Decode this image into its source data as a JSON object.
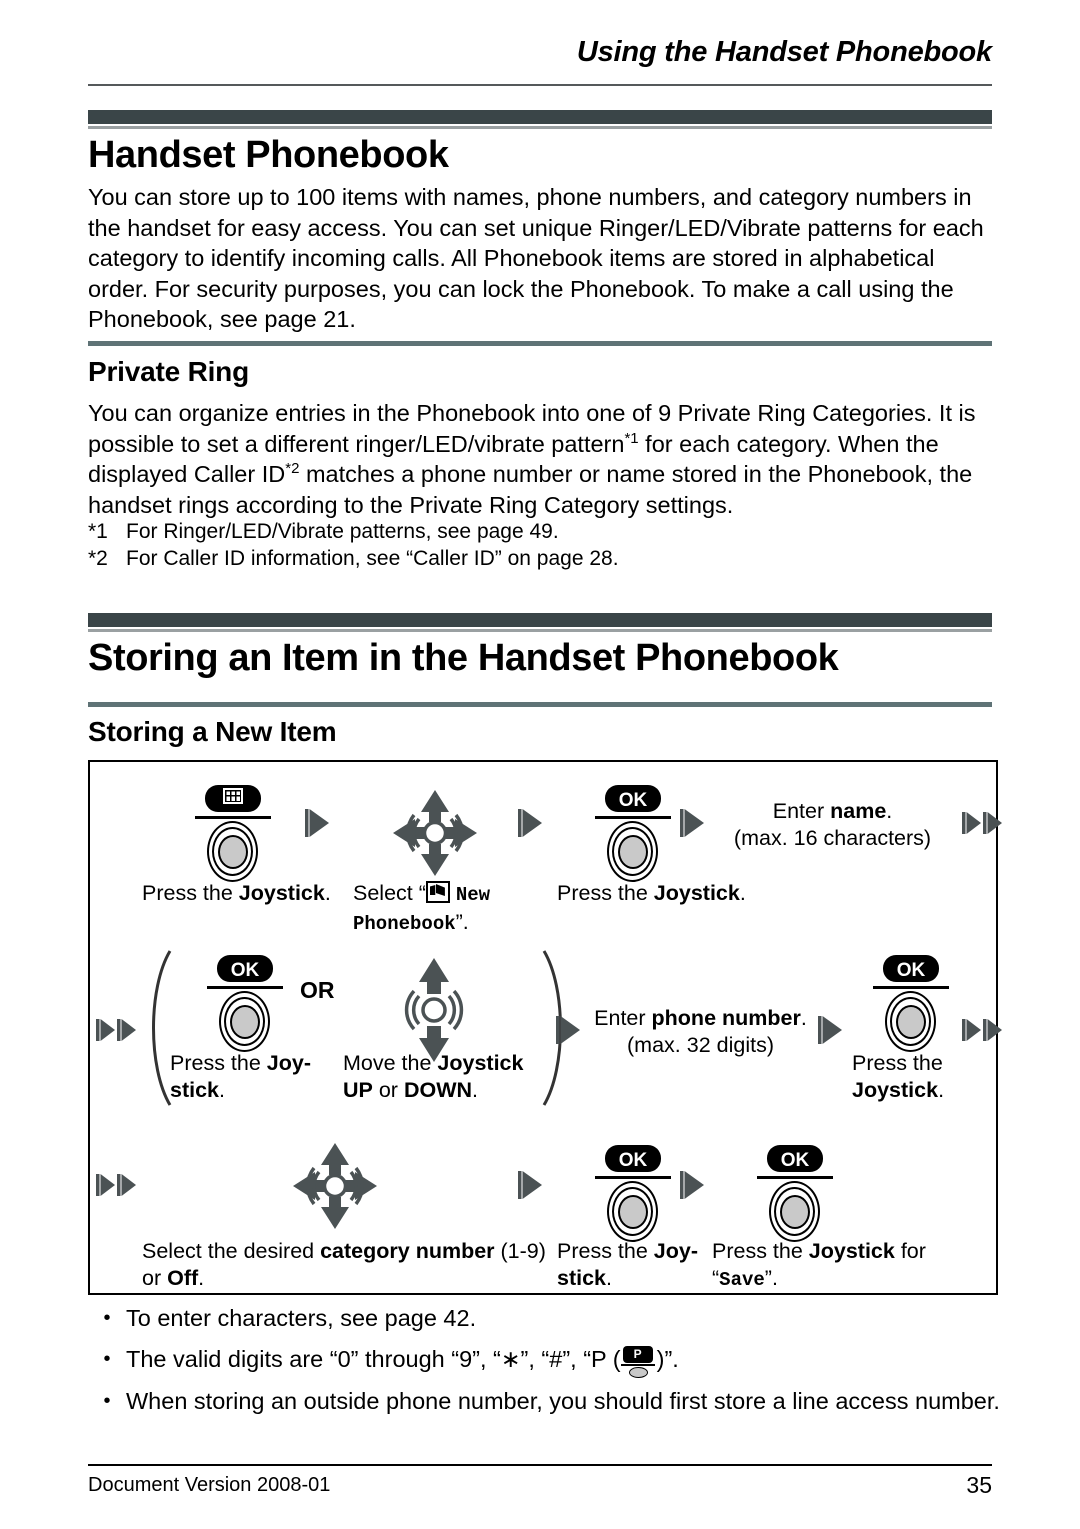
{
  "running_head": "Using the Handset Phonebook",
  "sections": {
    "handset_phonebook": {
      "title": "Handset Phonebook",
      "intro": "You can store up to 100 items with names, phone numbers, and category numbers in the handset for easy access. You can set unique Ringer/LED/Vibrate patterns for each category to identify incoming calls. All Phonebook items are stored in alphabetical order. For security purposes, you can lock the Phonebook. To make a call using the Phonebook, see page 21."
    },
    "private_ring": {
      "title": "Private Ring",
      "para_1": "You can organize entries in the Phonebook into one of 9 Private Ring Categories. It is possible to set a different ringer/LED/vibrate pattern",
      "sup_1": "*1",
      "para_2": " for each category. When the displayed Caller ID",
      "sup_2": "*2",
      "para_3": " matches a phone number or name stored in the Phonebook, the handset rings according to the Private Ring Category settings.",
      "footnotes": [
        {
          "marker": "*1",
          "text": "For Ringer/LED/Vibrate patterns, see page 49."
        },
        {
          "marker": "*2",
          "text": "For Caller ID information, see “Caller ID” on page 28."
        }
      ]
    },
    "storing_item": {
      "title": "Storing an Item in the Handset Phonebook",
      "subtitle": "Storing a New Item"
    }
  },
  "procedure": {
    "row1": {
      "step1": {
        "key_icon": "menu-key-icon",
        "caption_pre": "Press the ",
        "caption_bold": "Joystick",
        "caption_post": "."
      },
      "step2": {
        "nav_icon": "joystick-4way-icon",
        "caption_pre": "Select “",
        "caption_icon": "phonebook-glyph-icon",
        "caption_mono": "New Phonebook",
        "caption_post": "”."
      },
      "step3": {
        "key_icon": "ok-key-icon",
        "key_label": "OK",
        "caption_pre": "Press the ",
        "caption_bold": "Joystick",
        "caption_post": "."
      },
      "step4": {
        "line1_pre": "Enter ",
        "line1_bold": "name",
        "line1_post": ".",
        "line2": "(max. 16 characters)"
      }
    },
    "row2": {
      "step1": {
        "key_icon": "ok-key-icon",
        "key_label": "OK",
        "caption_pre": "Press the ",
        "caption_bold": "Joy-",
        "caption_bold2": "stick",
        "caption_post": "."
      },
      "or_label": "OR",
      "step2": {
        "nav_icon": "joystick-updown-icon",
        "caption_pre": "Move the ",
        "caption_bold": "Joystick",
        "caption_bold2": "UP",
        "caption_mid": " or ",
        "caption_bold3": "DOWN",
        "caption_post": "."
      },
      "step3": {
        "line1_pre": "Enter ",
        "line1_bold": "phone number",
        "line1_post": ".",
        "line2": "(max. 32 digits)"
      },
      "step4": {
        "key_icon": "ok-key-icon",
        "key_label": "OK",
        "caption_pre": "Press the",
        "caption_bold": "Joystick",
        "caption_post": "."
      }
    },
    "row3": {
      "step1": {
        "nav_icon": "joystick-4way-icon",
        "caption_pre": "Select the desired ",
        "caption_bold": "category number",
        "caption_post": " (1-9)",
        "caption_line2_pre": "or ",
        "caption_line2_bold": "Off",
        "caption_line2_post": "."
      },
      "step2": {
        "key_icon": "ok-key-icon",
        "key_label": "OK",
        "caption_pre": "Press the ",
        "caption_bold": "Joy-",
        "caption_bold2": "stick",
        "caption_post": "."
      },
      "step3": {
        "key_icon": "ok-key-icon",
        "key_label": "OK",
        "caption_pre": "Press the ",
        "caption_bold": "Joystick",
        "caption_mid": " for",
        "caption_line2_pre": "“",
        "caption_line2_mono": "Save",
        "caption_line2_post": "”."
      }
    }
  },
  "notes": [
    {
      "text": "To enter characters, see page 42."
    },
    {
      "pre": "The valid digits are “0” through “9”, “∗”, “#”, “P (",
      "icon": "pause-key-icon",
      "post": ")”."
    },
    {
      "text": "When storing an outside phone number, you should first store a line access number."
    }
  ],
  "footer": {
    "left": "Document Version  2008-01",
    "page_number": "35"
  },
  "colors": {
    "chapter_bar": "#3a4548",
    "rule_accent": "#5f7376",
    "head_rule": "#55595b",
    "icon_gray": "#4b5254",
    "key_fill": "#c9c9c9"
  }
}
